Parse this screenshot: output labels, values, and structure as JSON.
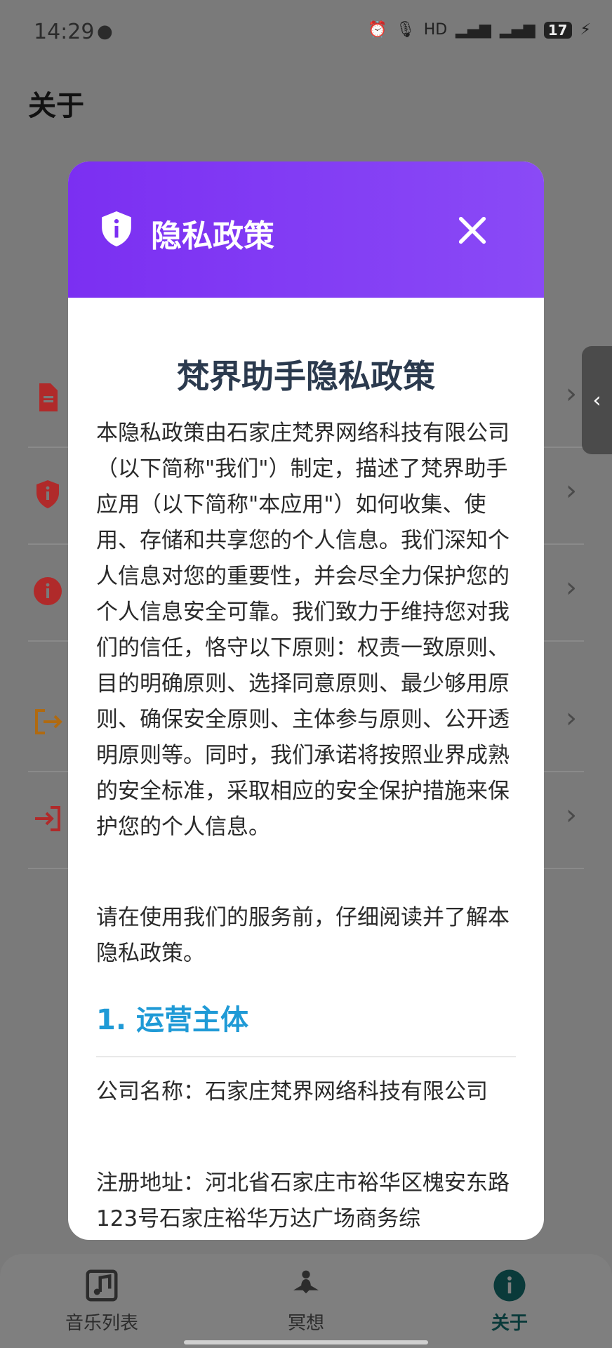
{
  "status_bar": {
    "time": "14:29",
    "battery": "17"
  },
  "page": {
    "title": "关于"
  },
  "dialog": {
    "title": "隐私政策",
    "doc_title": "梵界助手隐私政策",
    "intro_paragraph": "本隐私政策由石家庄梵界网络科技有限公司（以下简称\"我们\"）制定，描述了梵界助手应用（以下简称\"本应用\"）如何收集、使用、存储和共享您的个人信息。我们深知个人信息对您的重要性，并会尽全力保护您的个人信息安全可靠。我们致力于维持您对我们的信任，恪守以下原则：权责一致原则、目的明确原则、选择同意原则、最少够用原则、确保安全原则、主体参与原则、公开透明原则等。同时，我们承诺将按照业界成熟的安全标准，采取相应的安全保护措施来保护您的个人信息。",
    "notice_paragraph": "请在使用我们的服务前，仔细阅读并了解本隐私政策。",
    "section1_heading": "1. 运营主体",
    "company_name_line": "公司名称：石家庄梵界网络科技有限公司",
    "address_line": "注册地址：河北省石家庄市裕华区槐安东路123号石家庄裕华万达广场商务综"
  },
  "bottom_nav": {
    "items": [
      {
        "label": "音乐列表",
        "icon": "music-list-icon"
      },
      {
        "label": "冥想",
        "icon": "meditation-icon"
      },
      {
        "label": "关于",
        "icon": "info-icon"
      }
    ]
  },
  "colors": {
    "header_purple": "#7b2ff2",
    "section_blue": "#1f9ad6",
    "doc_title": "#2b3a4e"
  }
}
